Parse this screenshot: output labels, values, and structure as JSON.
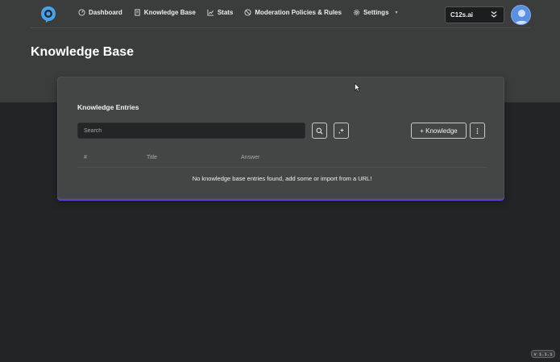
{
  "nav": {
    "items": [
      {
        "label": "Dashboard",
        "icon": "gauge-icon"
      },
      {
        "label": "Knowledge Base",
        "icon": "book-icon"
      },
      {
        "label": "Stats",
        "icon": "chart-icon"
      },
      {
        "label": "Moderation Policies & Rules",
        "icon": "ban-icon"
      },
      {
        "label": "Settings",
        "icon": "gear-icon"
      }
    ],
    "org_selected": "C12s.ai"
  },
  "page": {
    "title": "Knowledge Base"
  },
  "card": {
    "title": "Knowledge Entries",
    "search_placeholder": "Search",
    "add_label": "+ Knowledge",
    "columns": [
      "#",
      "Title",
      "Answer"
    ],
    "empty_message": "No knowledge base entries found, add some or import from a URL!"
  },
  "footer": {
    "version": "v 1.1.1"
  },
  "colors": {
    "accent": "#5b3fd0",
    "avatar": "#5b8fe0",
    "logo": "#4aa3e8"
  }
}
